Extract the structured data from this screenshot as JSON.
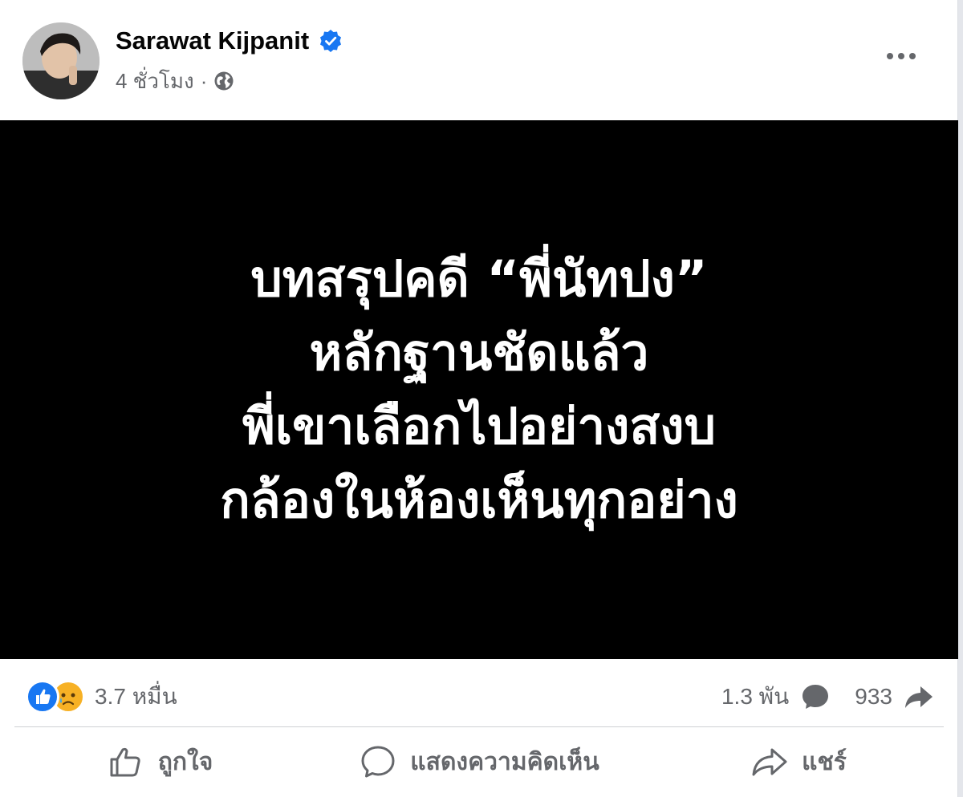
{
  "post": {
    "author": "Sarawat Kijpanit",
    "timestamp": "4 ชั่วโมง",
    "separator": "·",
    "verified_icon": "verified-badge-icon",
    "privacy_icon": "globe-icon",
    "more_icon": "more-options-icon"
  },
  "media": {
    "lines": [
      "บทสรุปคดี “พี่นัทปง”",
      "หลักฐานชัดแล้ว",
      "พี่เขาเลือกไปอย่างสงบ",
      "กล้องในห้องเห็นทุกอย่าง"
    ]
  },
  "stats": {
    "reactions_count": "3.7 หมื่น",
    "comments_count": "1.3 พัน",
    "shares_count": "933",
    "reaction_icons": [
      "like-reaction-icon",
      "sad-reaction-icon"
    ]
  },
  "actions": {
    "like": "ถูกใจ",
    "comment": "แสดงความคิดเห็น",
    "share": "แชร์"
  },
  "colors": {
    "brand_blue": "#1877f2",
    "secondary_text": "#65676b",
    "media_bg": "#000000"
  }
}
